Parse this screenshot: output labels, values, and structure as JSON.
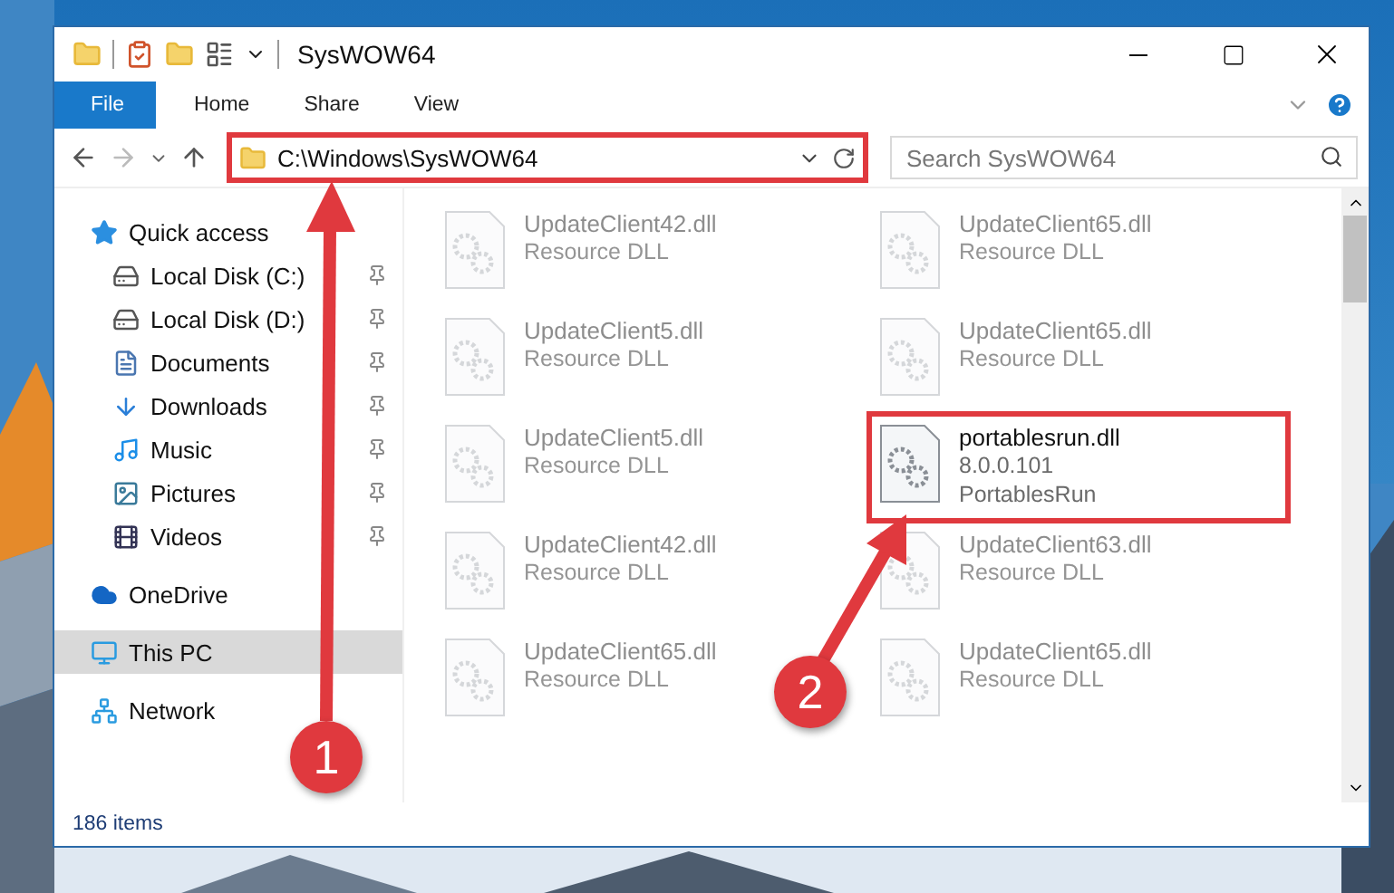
{
  "window": {
    "title": "SysWOW64"
  },
  "ribbon_tabs": [
    {
      "label": "File",
      "kind": "menu"
    },
    {
      "label": "Home",
      "kind": "tab"
    },
    {
      "label": "Share",
      "kind": "tab"
    },
    {
      "label": "View",
      "kind": "tab"
    }
  ],
  "address_bar": {
    "path": "C:\\Windows\\SysWOW64",
    "highlighted": true
  },
  "search": {
    "placeholder": "Search SysWOW64"
  },
  "sidebar": {
    "items": [
      {
        "label": "Quick access",
        "selected": false,
        "children": [
          {
            "label": "Local Disk (C:)",
            "pinned": true,
            "selected": false
          },
          {
            "label": "Local Disk (D:)",
            "pinned": true,
            "selected": false
          },
          {
            "label": "Documents",
            "pinned": true,
            "selected": false
          },
          {
            "label": "Downloads",
            "pinned": true,
            "selected": false
          },
          {
            "label": "Music",
            "pinned": true,
            "selected": false
          },
          {
            "label": "Pictures",
            "pinned": true,
            "selected": false
          },
          {
            "label": "Videos",
            "pinned": true,
            "selected": false
          }
        ]
      },
      {
        "label": "OneDrive",
        "selected": false
      },
      {
        "label": "This PC",
        "selected": true
      },
      {
        "label": "Network",
        "selected": false
      }
    ]
  },
  "files": [
    {
      "name": "UpdateClient42.dll",
      "details": [
        "Resource DLL"
      ],
      "blurred": true,
      "highlighted": false
    },
    {
      "name": "UpdateClient65.dll",
      "details": [
        "Resource DLL"
      ],
      "blurred": true,
      "highlighted": false
    },
    {
      "name": "UpdateClient5.dll",
      "details": [
        "Resource DLL"
      ],
      "blurred": true,
      "highlighted": false
    },
    {
      "name": "UpdateClient65.dll",
      "details": [
        "Resource DLL"
      ],
      "blurred": true,
      "highlighted": false
    },
    {
      "name": "UpdateClient5.dll",
      "details": [
        "Resource DLL"
      ],
      "blurred": true,
      "highlighted": false
    },
    {
      "name": "portablesrun.dll",
      "details": [
        "8.0.0.101",
        "PortablesRun"
      ],
      "blurred": false,
      "highlighted": true
    },
    {
      "name": "UpdateClient42.dll",
      "details": [
        "Resource DLL"
      ],
      "blurred": true,
      "highlighted": false
    },
    {
      "name": "UpdateClient63.dll",
      "details": [
        "Resource DLL"
      ],
      "blurred": true,
      "highlighted": false
    },
    {
      "name": "UpdateClient65.dll",
      "details": [
        "Resource DLL"
      ],
      "blurred": true,
      "highlighted": false
    },
    {
      "name": "UpdateClient65.dll",
      "details": [
        "Resource DLL"
      ],
      "blurred": true,
      "highlighted": false
    }
  ],
  "annotations": [
    {
      "number": "1"
    },
    {
      "number": "2"
    }
  ],
  "status_bar": {
    "item_count": "186 items"
  }
}
